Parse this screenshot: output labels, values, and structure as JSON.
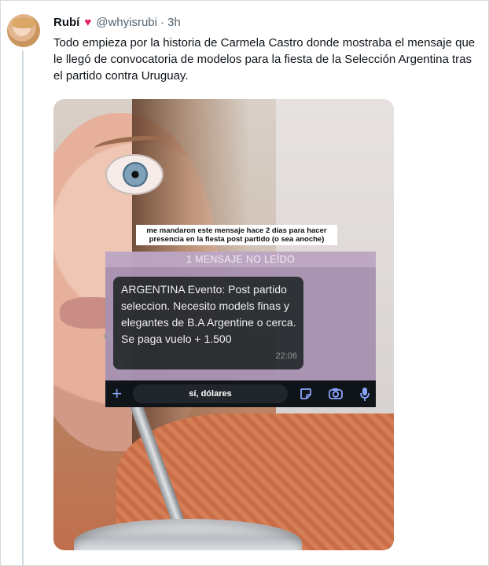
{
  "tweet": {
    "author_name": "Rubí",
    "handle": "@whyisrubi",
    "separator": "·",
    "time": "3h",
    "text": "Todo empieza por la historia de Carmela Castro donde mostraba el mensaje que le llegó de convocatoria de modelos para la fiesta de la Selección Argentina tras el partido contra Uruguay."
  },
  "media": {
    "story_caption": "me mandaron este mensaje hace 2 días para hacer presencia en la fiesta post partido (o sea anoche)",
    "chat": {
      "unread_banner": "1 MENSAJE NO LEÍDO",
      "message_text": "ARGENTINA Evento: Post partido seleccion.  Necesito models finas y elegantes de B.A Argentine  o cerca. Se paga vuelo + 1.500",
      "message_time": "22:06",
      "reply_text": "sí, dólares",
      "icons": [
        "plus-icon",
        "sticker-icon",
        "camera-icon",
        "microphone-icon"
      ]
    }
  },
  "colors": {
    "heart": "#e0245e",
    "chat_panel": "#a892b1",
    "bubble": "#2a2d31",
    "input_bar": "#0f1418",
    "accent_icons": "#8aa3ff"
  }
}
